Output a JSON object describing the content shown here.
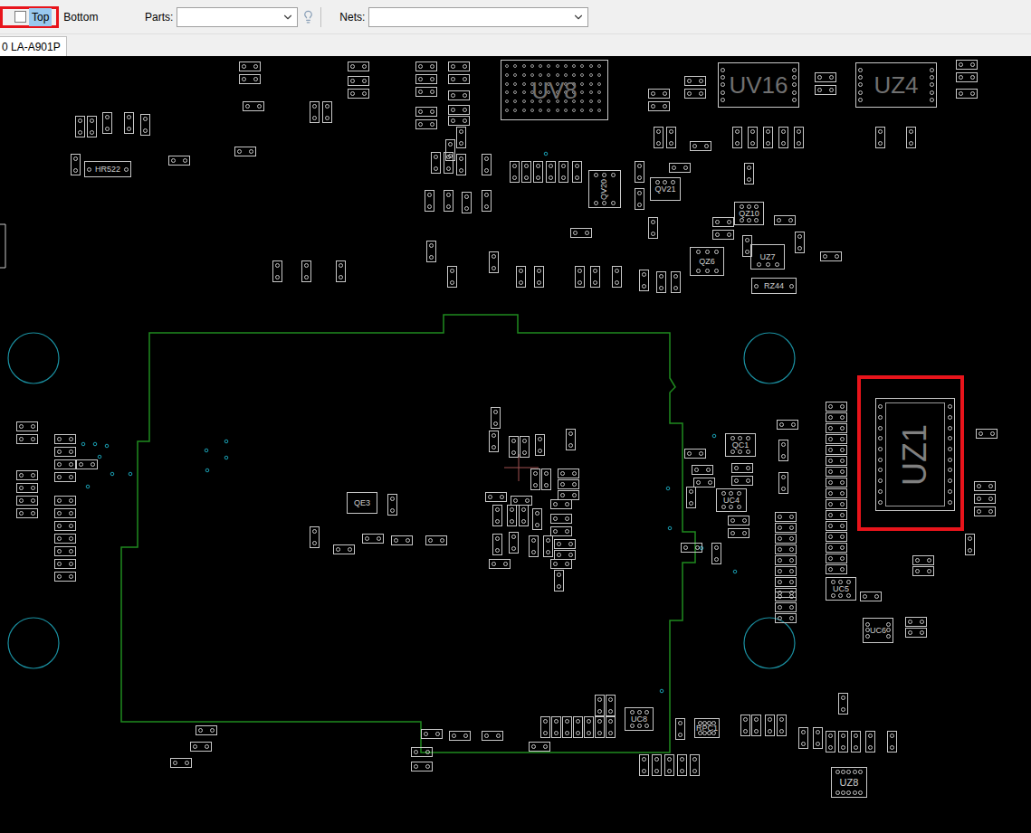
{
  "toolbar": {
    "layers": [
      {
        "label": "Top",
        "kind": "checkbox",
        "checked": false,
        "selected": true,
        "highlighted": true
      },
      {
        "label": "Bottom",
        "kind": "label",
        "checked": false,
        "selected": false,
        "highlighted": false
      }
    ],
    "parts_field": {
      "label": "Parts:",
      "value": ""
    },
    "nets_field": {
      "label": "Nets:",
      "value": ""
    }
  },
  "tabs": [
    {
      "label": "0 LA-A901P",
      "selected": true
    }
  ],
  "board": {
    "parts": [
      {
        "label": "HR522",
        "highlighted": false
      },
      {
        "label": "UV8",
        "highlighted": false
      },
      {
        "label": "UV16",
        "highlighted": false
      },
      {
        "label": "UZ4",
        "highlighted": false
      },
      {
        "label": "QV20",
        "highlighted": false
      },
      {
        "label": "QV21",
        "highlighted": false
      },
      {
        "label": "QZ10",
        "highlighted": false
      },
      {
        "label": "QZ6",
        "highlighted": false
      },
      {
        "label": "UZ7",
        "highlighted": false
      },
      {
        "label": "RZ44",
        "highlighted": false
      },
      {
        "label": "QC1",
        "highlighted": false
      },
      {
        "label": "UC4",
        "highlighted": false
      },
      {
        "label": "QE3",
        "highlighted": false
      },
      {
        "label": "UC5",
        "highlighted": false
      },
      {
        "label": "UC6",
        "highlighted": false
      },
      {
        "label": "UC8",
        "highlighted": false
      },
      {
        "label": "RPC1",
        "highlighted": false
      },
      {
        "label": "UZ8",
        "highlighted": false
      },
      {
        "label": "UZ1",
        "highlighted": true
      }
    ]
  }
}
